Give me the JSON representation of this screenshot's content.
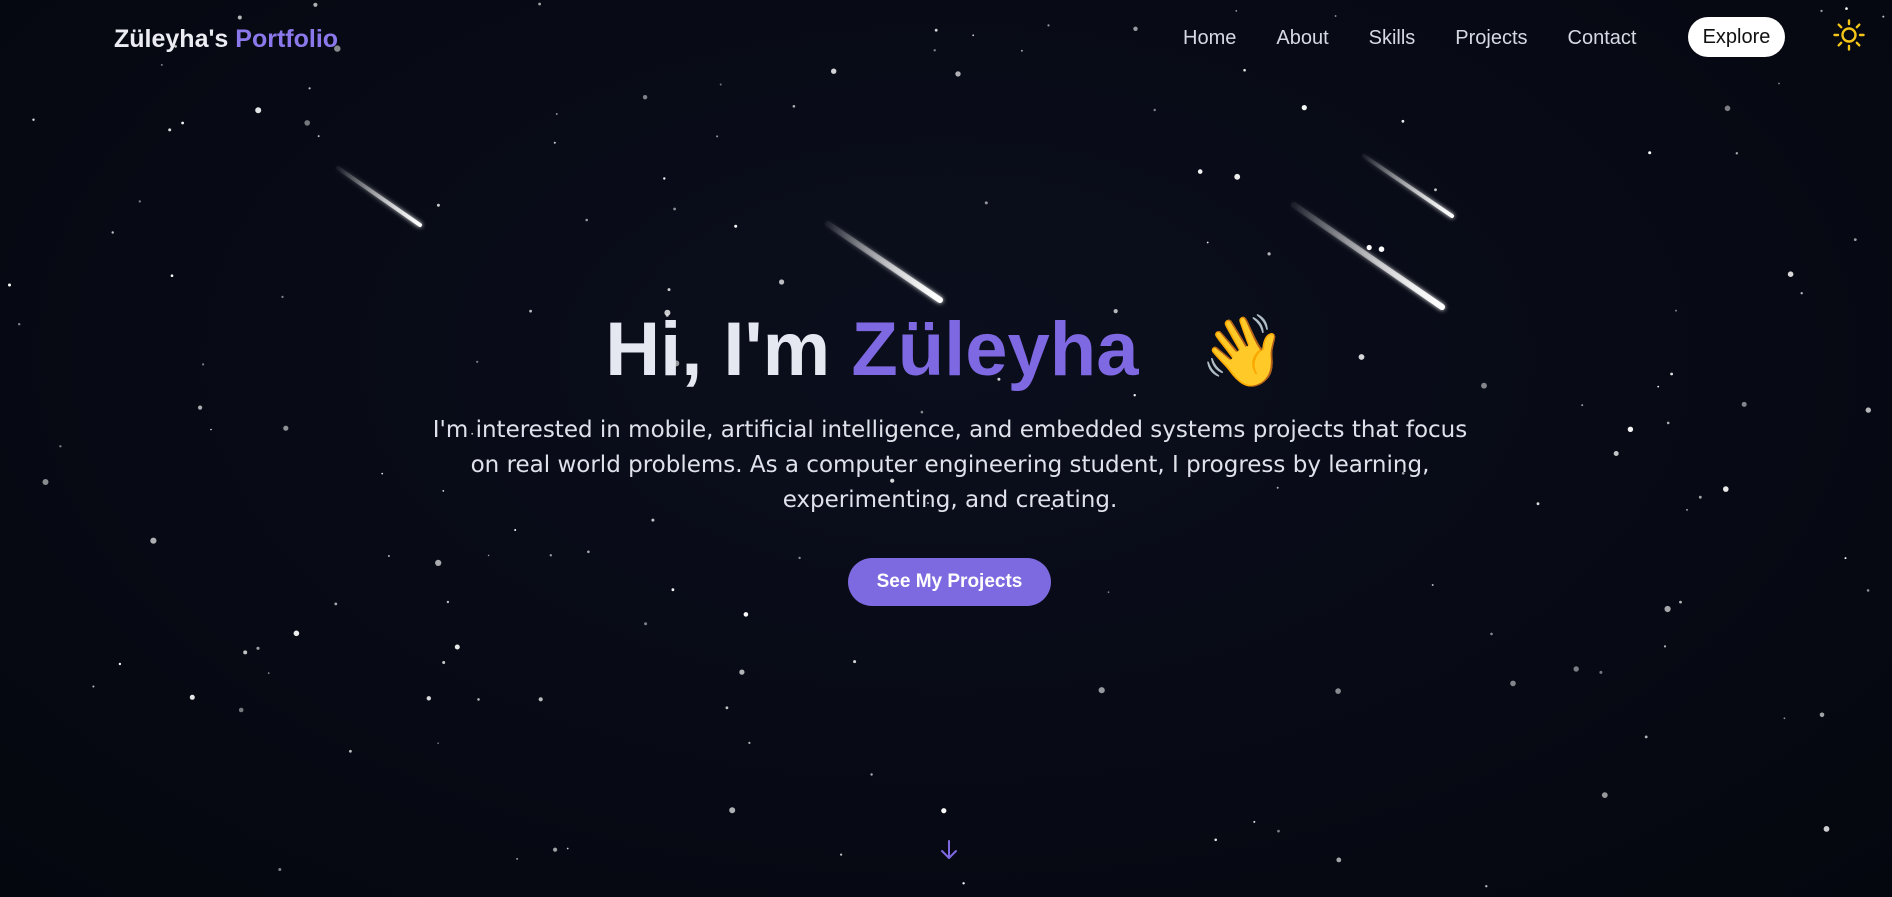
{
  "header": {
    "brand_name": "Züleyha's",
    "brand_suffix": "Portfolio",
    "nav_items": [
      "Home",
      "About",
      "Skills",
      "Projects",
      "Contact"
    ],
    "explore_label": "Explore",
    "theme_icon": "sun-icon"
  },
  "hero": {
    "greeting": "Hi, I'm",
    "name": "Züleyha",
    "wave_emoji": "👋",
    "subtitle": "I'm interested in mobile, artificial intelligence, and embedded systems projects that focus on real world problems. As a computer engineering student, I progress by learning, experimenting, and creating.",
    "cta_label": "See My Projects",
    "scroll_icon": "arrow-down-icon"
  },
  "colors": {
    "background": "#070a14",
    "accent": "#7f69e3",
    "text": "#e5e8f1",
    "sun": "#f5c518"
  }
}
